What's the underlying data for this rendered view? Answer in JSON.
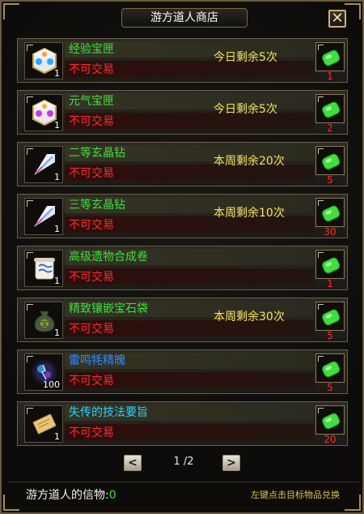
{
  "window": {
    "title": "游方道人商店",
    "close_label": "✕"
  },
  "items": [
    {
      "name": "经验宝匣",
      "name_color": "#3fdf3f",
      "qty": "1",
      "trade": "不可交易",
      "limit": "今日剩余5次",
      "price": "1",
      "icon": "experience-box-icon"
    },
    {
      "name": "元气宝匣",
      "name_color": "#3fdf3f",
      "qty": "1",
      "trade": "不可交易",
      "limit": "今日剩余5次",
      "price": "2",
      "icon": "vitality-box-icon"
    },
    {
      "name": "二等玄晶钻",
      "name_color": "#3fdf3f",
      "qty": "1",
      "trade": "不可交易",
      "limit": "本周剩余20次",
      "price": "5",
      "icon": "crystal-drill-icon"
    },
    {
      "name": "三等玄晶钻",
      "name_color": "#3fdf3f",
      "qty": "1",
      "trade": "不可交易",
      "limit": "本周剩余10次",
      "price": "30",
      "icon": "crystal-drill-icon"
    },
    {
      "name": "高级遗物合成卷",
      "name_color": "#3fdf3f",
      "qty": "1",
      "trade": "不可交易",
      "limit": "",
      "price": "1",
      "icon": "relic-scroll-icon"
    },
    {
      "name": "精致镶嵌宝石袋",
      "name_color": "#3fdf3f",
      "qty": "1",
      "trade": "不可交易",
      "limit": "本周剩余30次",
      "price": "5",
      "icon": "gem-bag-icon"
    },
    {
      "name": "雷鸣牦精魄",
      "name_color": "#2f8cff",
      "qty": "100",
      "trade": "不可交易",
      "limit": "",
      "price": "5",
      "icon": "thunder-spirit-orb-icon"
    },
    {
      "name": "失传的技法要旨",
      "name_color": "#28d4ff",
      "qty": "1",
      "trade": "不可交易",
      "limit": "",
      "price": "20",
      "icon": "lost-technique-manual-icon"
    }
  ],
  "pager": {
    "prev_label": "<",
    "next_label": ">",
    "page_text": "1 /2"
  },
  "footer": {
    "token_label": "游方道人的信物",
    "token_sep": ":",
    "token_value": "0",
    "hint": "左键点击目标物品兑换"
  },
  "colors": {
    "frame": "#6a5a3e",
    "trade_red": "#ff2a2a",
    "limit_yellow": "#f6e35a",
    "currency_green": "#3fdf3f"
  }
}
